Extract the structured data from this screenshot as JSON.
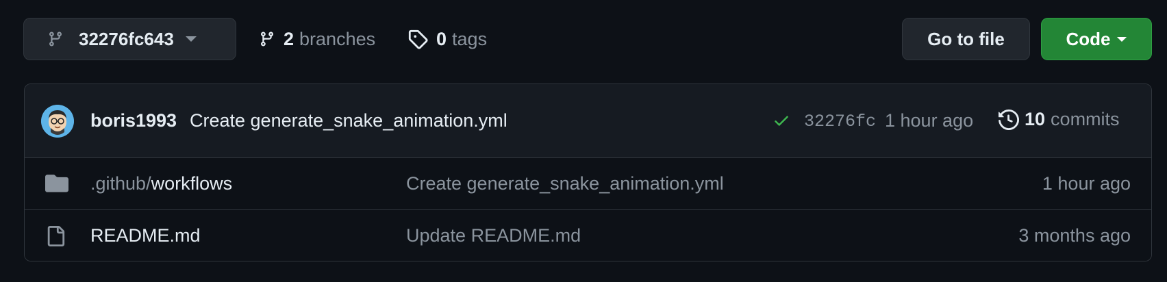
{
  "toolbar": {
    "branch_selector": "32276fc643",
    "branches_count": "2",
    "branches_label": "branches",
    "tags_count": "0",
    "tags_label": "tags",
    "goto_file_label": "Go to file",
    "code_label": "Code"
  },
  "latest_commit": {
    "author": "boris1993",
    "message": "Create generate_snake_animation.yml",
    "status": "success",
    "sha": "32276fc",
    "time": "1 hour ago",
    "commits_count": "10",
    "commits_label": "commits"
  },
  "files": [
    {
      "type": "folder",
      "name_prefix": ".github/",
      "name": "workflows",
      "message": "Create generate_snake_animation.yml",
      "age": "1 hour ago"
    },
    {
      "type": "file",
      "name_prefix": "",
      "name": "README.md",
      "message": "Update README.md",
      "age": "3 months ago"
    }
  ],
  "colors": {
    "background": "#0d1117",
    "header": "#161b22",
    "border": "#30363d",
    "code_button": "#238636",
    "success_check": "#3fb950",
    "muted_text": "#8b949e"
  }
}
